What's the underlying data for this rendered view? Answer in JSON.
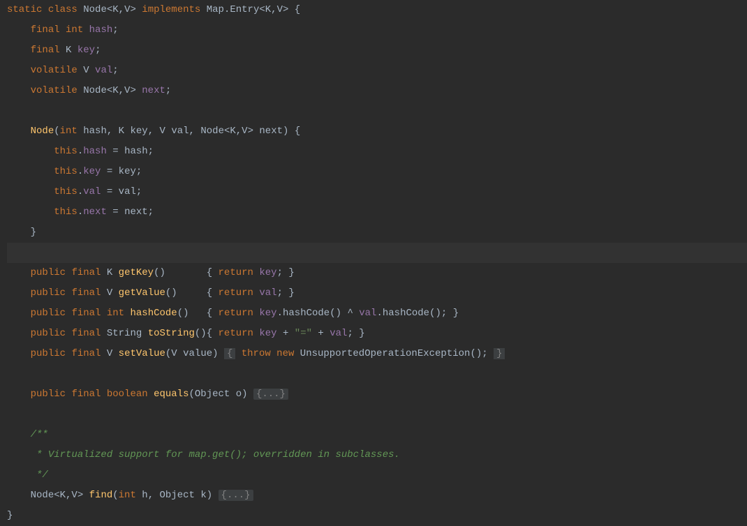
{
  "code": {
    "l1": {
      "kw_static": "static",
      "kw_class": "class",
      "cls": "Node",
      "gen1": "<",
      "K": "K",
      "comma1": ",",
      "V": "V",
      "gen2": ">",
      "kw_impl": "implements",
      "map": "Map",
      "dot": ".",
      "entry": "Entry",
      "gen3": "<",
      "K2": "K",
      "comma2": ",",
      "V2": "V",
      "gen4": ">",
      "brace": "{"
    },
    "l2": {
      "kw_final": "final",
      "kw_int": "int",
      "field": "hash",
      "semi": ";"
    },
    "l3": {
      "kw_final": "final",
      "K": "K",
      "field": "key",
      "semi": ";"
    },
    "l4": {
      "kw_vol": "volatile",
      "V": "V",
      "field": "val",
      "semi": ";"
    },
    "l5": {
      "kw_vol": "volatile",
      "node": "Node",
      "gen": "<K,V>",
      "field": "next",
      "semi": ";"
    },
    "l7": {
      "node": "Node",
      "lp": "(",
      "kw_int": "int",
      "p1": "hash",
      "c1": ",",
      "K": "K",
      "p2": "key",
      "c2": ",",
      "V": "V",
      "p3": "val",
      "c3": ",",
      "node2": "Node",
      "gen": "<K,V>",
      "p4": "next",
      "rp": ")",
      "brace": "{"
    },
    "l8": {
      "kw_this": "this",
      "dot": ".",
      "fld": "hash",
      "eq": "=",
      "var": "hash",
      "semi": ";"
    },
    "l9": {
      "kw_this": "this",
      "dot": ".",
      "fld": "key",
      "eq": "=",
      "var": "key",
      "semi": ";"
    },
    "l10": {
      "kw_this": "this",
      "dot": ".",
      "fld": "val",
      "eq": "=",
      "var": "val",
      "semi": ";"
    },
    "l11": {
      "kw_this": "this",
      "dot": ".",
      "fld": "next",
      "eq": "=",
      "var": "next",
      "semi": ";"
    },
    "l12": {
      "brace": "}"
    },
    "l14": {
      "pub": "public",
      "fin": "final",
      "K": "K",
      "m": "getKey",
      "par": "()",
      "lb": "{",
      "ret": "return",
      "fld": "key",
      "semi": ";",
      "rb": "}"
    },
    "l15": {
      "pub": "public",
      "fin": "final",
      "V": "V",
      "m": "getValue",
      "par": "()",
      "lb": "{",
      "ret": "return",
      "fld": "val",
      "semi": ";",
      "rb": "}"
    },
    "l16": {
      "pub": "public",
      "fin": "final",
      "int": "int",
      "m": "hashCode",
      "par": "()",
      "lb": "{",
      "ret": "return",
      "fld1": "key",
      "dot1": ".",
      "m1": "hashCode",
      "par1": "()",
      "xor": "^",
      "fld2": "val",
      "dot2": ".",
      "m2": "hashCode",
      "par2": "()",
      "semi": ";",
      "rb": "}"
    },
    "l17": {
      "pub": "public",
      "fin": "final",
      "str": "String",
      "m": "toString",
      "par": "()",
      "lb": "{",
      "ret": "return",
      "fld1": "key",
      "plus1": "+",
      "eq": "\"=\"",
      "plus2": "+",
      "fld2": "val",
      "semi": ";",
      "rb": "}"
    },
    "l18": {
      "pub": "public",
      "fin": "final",
      "V": "V",
      "m": "setValue",
      "lp": "(",
      "V2": "V",
      "p": "value",
      "rp": ")",
      "fold_open": "{",
      "thr": "throw",
      "new": "new",
      "cls": "UnsupportedOperationException",
      "par": "()",
      "semi": ";",
      "fold_close": "}"
    },
    "l20": {
      "pub": "public",
      "fin": "final",
      "bool": "boolean",
      "m": "equals",
      "lp": "(",
      "obj": "Object",
      "p": "o",
      "rp": ")",
      "fold": "{...}"
    },
    "l22": {
      "c": "/**"
    },
    "l23": {
      "c": " * Virtualized support for map.get(); overridden in subclasses."
    },
    "l24": {
      "c": " */"
    },
    "l25": {
      "node": "Node",
      "gen": "<K,V>",
      "m": "find",
      "lp": "(",
      "int": "int",
      "p1": "h",
      "c": ",",
      "obj": "Object",
      "p2": "k",
      "rp": ")",
      "fold": "{...}"
    },
    "l26": {
      "brace": "}"
    }
  }
}
